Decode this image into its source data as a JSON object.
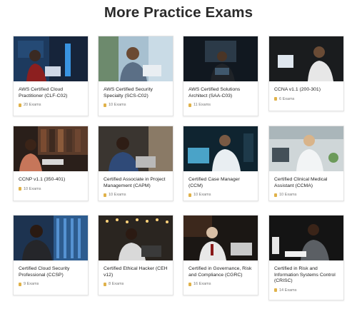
{
  "page_title": "More Practice Exams",
  "accent_icon_color": "#e0b24a",
  "cards": [
    {
      "title": "AWS Certified Cloud Practitioner (CLF-C02)",
      "count": "20 Exams",
      "photo": "woman-laptop-night"
    },
    {
      "title": "AWS Certified Security Specialty (SCS-C02)",
      "count": "10 Exams",
      "photo": "man-laptop-office"
    },
    {
      "title": "AWS Certified Solutions Architect (SAA-C03)",
      "count": "11 Exams",
      "photo": "man-monitor-dark"
    },
    {
      "title": "CCNA v1.1 (200-301)",
      "count": "6 Exams",
      "photo": "woman-laptop-dark"
    },
    {
      "title": "CCNP v1.1 (350-401)",
      "count": "10 Exams",
      "photo": "woman-library-laptop"
    },
    {
      "title": "Certified Associate in Project Management (CAPM)",
      "count": "10 Exams",
      "photo": "woman-glasses-laptop"
    },
    {
      "title": "Certified Case Manager (CCM)",
      "count": "10 Exams",
      "photo": "doctor-monitor"
    },
    {
      "title": "Certified Clinical Medical Assistant (CCMA)",
      "count": "10 Exams",
      "photo": "nurse-clinic"
    },
    {
      "title": "Certified Cloud Security Professional (CCSP)",
      "count": "9 Exams",
      "photo": "man-server-room"
    },
    {
      "title": "Certified Ethical Hacker (CEH v12)",
      "count": "8 Exams",
      "photo": "man-laptop-lights"
    },
    {
      "title": "Certified in Governance, Risk and Compliance (CGRC)",
      "count": "16 Exams",
      "photo": "man-suit-laptop"
    },
    {
      "title": "Certified in Risk and Information Systems Control (CRISC)",
      "count": "14 Exams",
      "photo": "woman-writing-desk"
    }
  ]
}
